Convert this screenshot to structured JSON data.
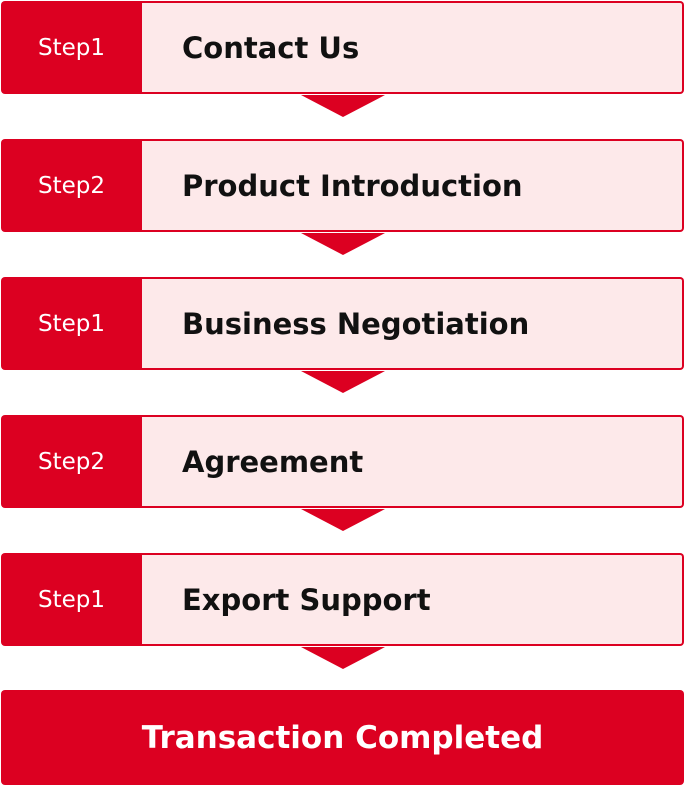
{
  "steps": [
    {
      "badge": "Step1",
      "title": "Contact Us"
    },
    {
      "badge": "Step2",
      "title": "Product Introduction"
    },
    {
      "badge": "Step1",
      "title": "Business Negotiation"
    },
    {
      "badge": "Step2",
      "title": "Agreement"
    },
    {
      "badge": "Step1",
      "title": "Export Support"
    }
  ],
  "final": {
    "label": "Transaction Completed"
  },
  "colors": {
    "accent": "#dc0021",
    "step_background": "#fde9ea"
  }
}
